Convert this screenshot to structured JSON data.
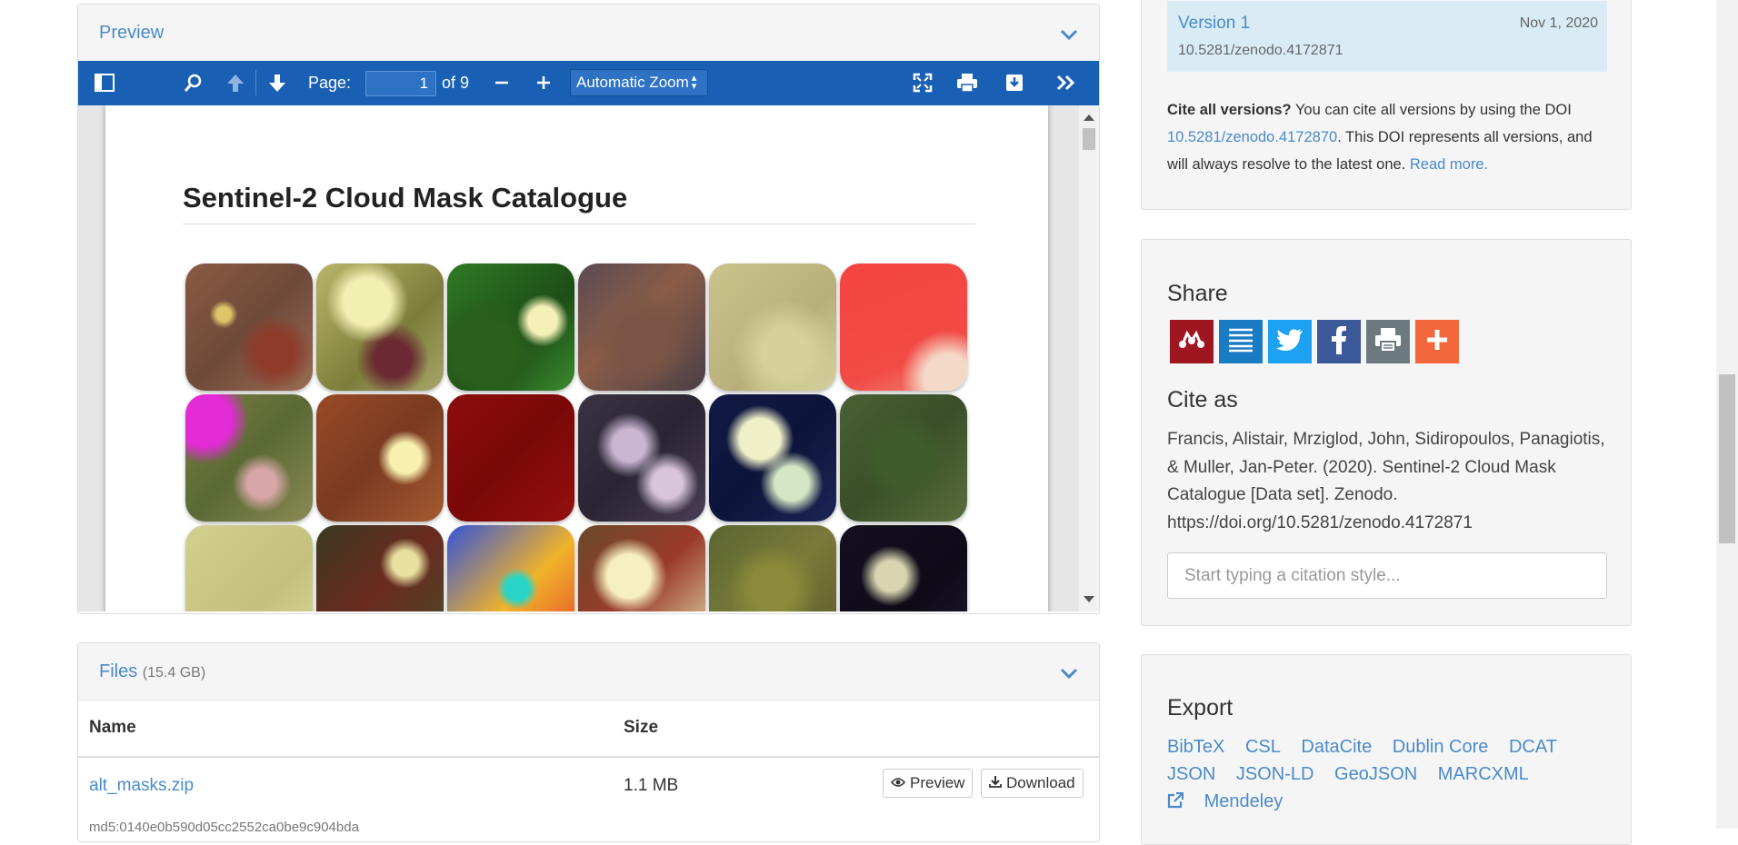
{
  "preview": {
    "title": "Preview",
    "toolbar": {
      "page_label": "Page:",
      "page_value": "1",
      "page_of": "of 9",
      "zoom": "Automatic Zoom"
    },
    "pdf": {
      "title": "Sentinel-2 Cloud Mask Catalogue"
    }
  },
  "files": {
    "title": "Files",
    "size_total": "(15.4 GB)",
    "columns": [
      "Name",
      "Size"
    ],
    "rows": [
      {
        "name": "alt_masks.zip",
        "size": "1.1 MB",
        "preview_label": "Preview",
        "download_label": "Download",
        "md5": "md5:0140e0b590d05cc2552ca0be9c904bda"
      }
    ]
  },
  "versions": {
    "label": "Version 1",
    "date": "Nov 1, 2020",
    "doi": "10.5281/zenodo.4172871",
    "cite_all_bold": "Cite all versions?",
    "cite_all_text1": "You can cite all versions by using the DOI",
    "cite_all_doi": "10.5281/zenodo.4172870",
    "cite_all_text2": ". This DOI represents all versions, and will always resolve to the latest one.",
    "read_more": "Read more."
  },
  "share": {
    "heading": "Share",
    "buttons": [
      {
        "icon": "mendeley-icon",
        "color": "#9d1620"
      },
      {
        "icon": "list-icon",
        "color": "#1a7bc5"
      },
      {
        "icon": "twitter-icon",
        "color": "#1da1f2"
      },
      {
        "icon": "facebook-icon",
        "color": "#3b5998"
      },
      {
        "icon": "print-icon",
        "color": "#6c7a80"
      },
      {
        "icon": "plus-icon",
        "color": "#f4663b"
      }
    ]
  },
  "cite_as": {
    "heading": "Cite as",
    "text": "Francis, Alistair, Mrziglod, John, Sidiropoulos, Panagiotis, & Muller, Jan-Peter. (2020). Sentinel-2 Cloud Mask Catalogue [Data set]. Zenodo. https://doi.org/10.5281/zenodo.4172871",
    "placeholder": "Start typing a citation style..."
  },
  "export": {
    "heading": "Export",
    "links": [
      "BibTeX",
      "CSL",
      "DataCite",
      "Dublin Core",
      "DCAT",
      "JSON",
      "JSON-LD",
      "GeoJSON",
      "MARCXML",
      "Mendeley"
    ]
  }
}
